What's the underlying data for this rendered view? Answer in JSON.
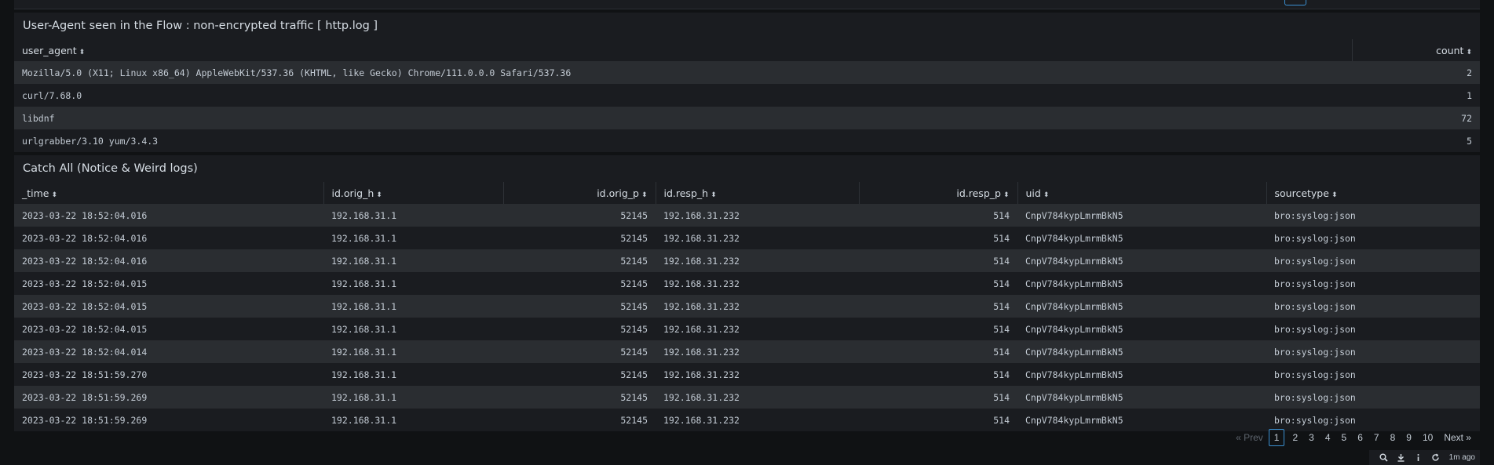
{
  "panel1": {
    "title": "User-Agent seen in the Flow : non-encrypted traffic [ http.log ]",
    "columns": [
      "user_agent",
      "count"
    ],
    "rows": [
      {
        "user_agent": "Mozilla/5.0 (X11; Linux x86_64) AppleWebKit/537.36 (KHTML, like Gecko) Chrome/111.0.0.0 Safari/537.36",
        "count": "2"
      },
      {
        "user_agent": "curl/7.68.0",
        "count": "1"
      },
      {
        "user_agent": "libdnf",
        "count": "72"
      },
      {
        "user_agent": "urlgrabber/3.10 yum/3.4.3",
        "count": "5"
      }
    ]
  },
  "panel2": {
    "title": "Catch All (Notice & Weird logs)",
    "columns": [
      "_time",
      "id.orig_h",
      "id.orig_p",
      "id.resp_h",
      "id.resp_p",
      "uid",
      "sourcetype"
    ],
    "rows": [
      {
        "time": "2023-03-22 18:52:04.016",
        "orig_h": "192.168.31.1",
        "orig_p": "52145",
        "resp_h": "192.168.31.232",
        "resp_p": "514",
        "uid": "CnpV784kypLmrmBkN5",
        "sourcetype": "bro:syslog:json"
      },
      {
        "time": "2023-03-22 18:52:04.016",
        "orig_h": "192.168.31.1",
        "orig_p": "52145",
        "resp_h": "192.168.31.232",
        "resp_p": "514",
        "uid": "CnpV784kypLmrmBkN5",
        "sourcetype": "bro:syslog:json"
      },
      {
        "time": "2023-03-22 18:52:04.016",
        "orig_h": "192.168.31.1",
        "orig_p": "52145",
        "resp_h": "192.168.31.232",
        "resp_p": "514",
        "uid": "CnpV784kypLmrmBkN5",
        "sourcetype": "bro:syslog:json"
      },
      {
        "time": "2023-03-22 18:52:04.015",
        "orig_h": "192.168.31.1",
        "orig_p": "52145",
        "resp_h": "192.168.31.232",
        "resp_p": "514",
        "uid": "CnpV784kypLmrmBkN5",
        "sourcetype": "bro:syslog:json"
      },
      {
        "time": "2023-03-22 18:52:04.015",
        "orig_h": "192.168.31.1",
        "orig_p": "52145",
        "resp_h": "192.168.31.232",
        "resp_p": "514",
        "uid": "CnpV784kypLmrmBkN5",
        "sourcetype": "bro:syslog:json"
      },
      {
        "time": "2023-03-22 18:52:04.015",
        "orig_h": "192.168.31.1",
        "orig_p": "52145",
        "resp_h": "192.168.31.232",
        "resp_p": "514",
        "uid": "CnpV784kypLmrmBkN5",
        "sourcetype": "bro:syslog:json"
      },
      {
        "time": "2023-03-22 18:52:04.014",
        "orig_h": "192.168.31.1",
        "orig_p": "52145",
        "resp_h": "192.168.31.232",
        "resp_p": "514",
        "uid": "CnpV784kypLmrmBkN5",
        "sourcetype": "bro:syslog:json"
      },
      {
        "time": "2023-03-22 18:51:59.270",
        "orig_h": "192.168.31.1",
        "orig_p": "52145",
        "resp_h": "192.168.31.232",
        "resp_p": "514",
        "uid": "CnpV784kypLmrmBkN5",
        "sourcetype": "bro:syslog:json"
      },
      {
        "time": "2023-03-22 18:51:59.269",
        "orig_h": "192.168.31.1",
        "orig_p": "52145",
        "resp_h": "192.168.31.232",
        "resp_p": "514",
        "uid": "CnpV784kypLmrmBkN5",
        "sourcetype": "bro:syslog:json"
      },
      {
        "time": "2023-03-22 18:51:59.269",
        "orig_h": "192.168.31.1",
        "orig_p": "52145",
        "resp_h": "192.168.31.232",
        "resp_p": "514",
        "uid": "CnpV784kypLmrmBkN5",
        "sourcetype": "bro:syslog:json"
      }
    ]
  },
  "pagination": {
    "prev": "« Prev",
    "pages": [
      "1",
      "2",
      "3",
      "4",
      "5",
      "6",
      "7",
      "8",
      "9",
      "10"
    ],
    "active": "1",
    "next": "Next »"
  },
  "footer": {
    "icons": [
      "search-icon",
      "download-icon",
      "info-icon",
      "refresh-icon"
    ],
    "refreshed": "1m ago"
  },
  "colors": {
    "background": "#101214",
    "panel": "#1a1c20",
    "row_stripe": "#2a2d31",
    "accent": "#3a8fd0"
  }
}
